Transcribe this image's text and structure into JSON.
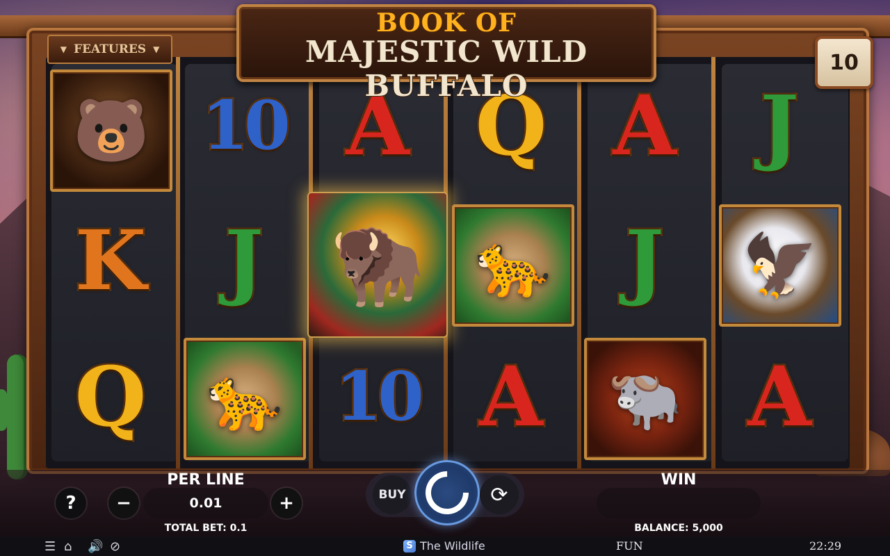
{
  "title": {
    "line1": "BOOK OF",
    "line2": "MAJESTIC WILD BUFFALO"
  },
  "features_label": "FEATURES",
  "lines_count": "10",
  "reels": [
    [
      "bear",
      "K",
      "Q"
    ],
    [
      "10",
      "J",
      "cougar"
    ],
    [
      "A",
      "book",
      "10"
    ],
    [
      "Q",
      "cougar",
      "A"
    ],
    [
      "A",
      "J",
      "buffalo"
    ],
    [
      "J",
      "eagle",
      "A"
    ]
  ],
  "controls": {
    "help_label": "?",
    "minus_label": "−",
    "plus_label": "+",
    "per_line_label": "PER LINE",
    "per_line_value": "0.01",
    "total_bet": "TOTAL BET: 0.1",
    "buy_label": "BUY",
    "win_label": "WIN",
    "win_value": "",
    "balance": "BALANCE: 5,000"
  },
  "bottom_bar": {
    "brand": "The Wildlife",
    "mode": "FUN",
    "time": "22:29"
  },
  "icons": {
    "menu": "menu-icon",
    "home": "home-icon",
    "sound": "sound-icon",
    "turbo": "turbo-icon"
  },
  "colors": {
    "frame_wood": "#7a4422",
    "spin_blue": "#274c86",
    "letter_red": "#d8261e",
    "letter_blue": "#2f62c8",
    "letter_gold": "#f1b21a",
    "letter_green": "#2e9a3a"
  }
}
